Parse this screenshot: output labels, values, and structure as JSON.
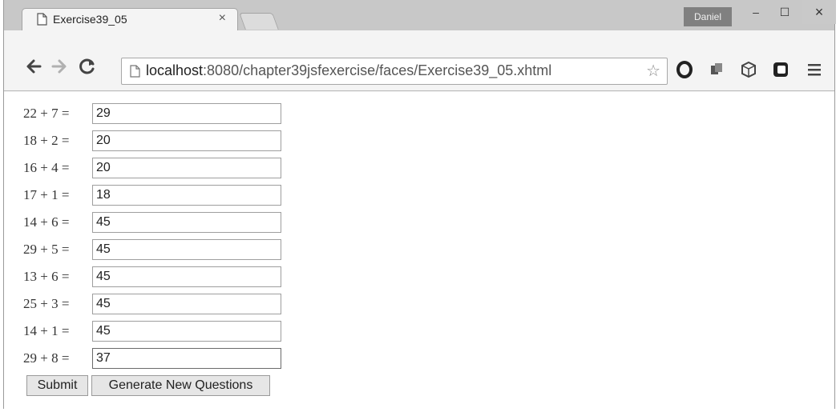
{
  "browser": {
    "tab_title": "Exercise39_05",
    "tab_close": "×",
    "user": "Daniel",
    "window_min": "–",
    "window_max": "☐",
    "window_close": "×",
    "url_host": "localhost",
    "url_path": ":8080/chapter39jsfexercise/faces/Exercise39_05.xhtml",
    "icons": [
      "doc-icon",
      "back-icon",
      "forward-icon",
      "reload-icon",
      "star-icon",
      "opera-icon",
      "puzzle-icon",
      "box-icon",
      "square-icon",
      "menu-icon"
    ]
  },
  "form": {
    "questions": [
      {
        "label": "22 + 7 =",
        "answer": "29"
      },
      {
        "label": "18 + 2 =",
        "answer": "20"
      },
      {
        "label": "16 + 4 =",
        "answer": "20"
      },
      {
        "label": "17 + 1 =",
        "answer": "18"
      },
      {
        "label": "14 + 6 =",
        "answer": "45"
      },
      {
        "label": "29 + 5 =",
        "answer": "45"
      },
      {
        "label": "13 + 6 =",
        "answer": "45"
      },
      {
        "label": "25 + 3 =",
        "answer": "45"
      },
      {
        "label": "14 + 1 =",
        "answer": "45"
      },
      {
        "label": "29 + 8 =",
        "answer": "37"
      }
    ],
    "submit_label": "Submit",
    "generate_label": "Generate New Questions"
  }
}
